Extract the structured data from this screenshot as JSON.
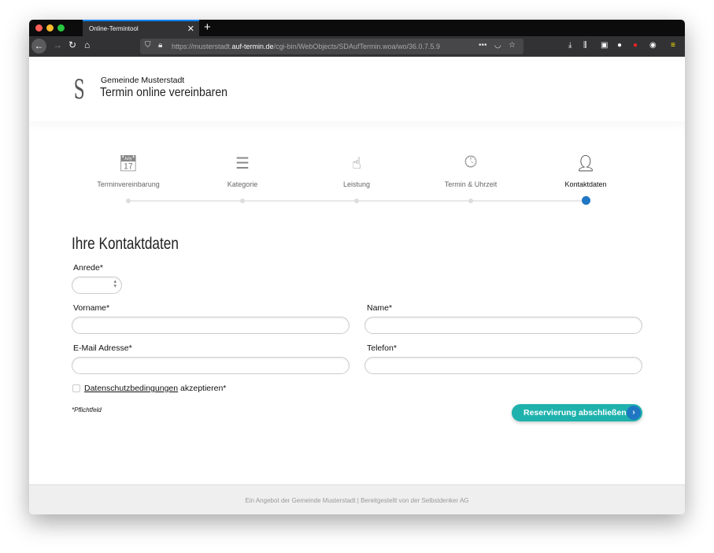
{
  "browser": {
    "tab_title": "Online-Termintool",
    "url_prefix": "https://musterstadt.",
    "url_domain": "auf-termin.de",
    "url_path": "/cgi-bin/WebObjects/SDAufTermin.woa/wo/36.0.7.5.9"
  },
  "header": {
    "logo_letter": "S",
    "org": "Gemeinde Musterstadt",
    "title": "Termin online vereinbaren"
  },
  "steps": [
    {
      "label": "Terminvereinbarung",
      "icon": "calendar-icon"
    },
    {
      "label": "Kategorie",
      "icon": "list-icon"
    },
    {
      "label": "Leistung",
      "icon": "hand-pointer-icon"
    },
    {
      "label": "Termin & Uhrzeit",
      "icon": "calendar-clock-icon"
    },
    {
      "label": "Kontaktdaten",
      "icon": "contact-card-icon",
      "active": true
    }
  ],
  "form": {
    "heading": "Ihre Kontaktdaten",
    "anrede": "Anrede*",
    "anrede_value": "",
    "vorname": "Vorname*",
    "name": "Name*",
    "email": "E-Mail Adresse*",
    "telefon": "Telefon*",
    "privacy_link": "Datenschutzbedingungen",
    "privacy_suffix": " akzeptieren*",
    "required_note": "*Pflichtfeld",
    "submit": "Reservierung abschließen"
  },
  "footer": {
    "text": "Ein Angebot der Gemeinde Musterstadt | Bereitgestellt von der Selbstdenker AG"
  },
  "colors": {
    "accent": "#1fb2ad",
    "active_step": "#1f77c3"
  }
}
